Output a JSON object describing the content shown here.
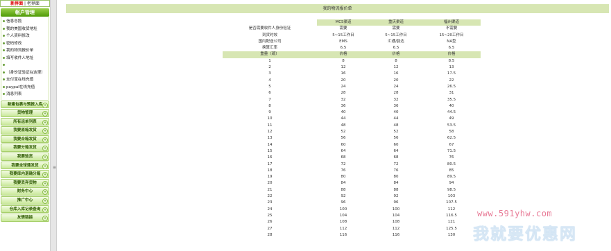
{
  "sidebar": {
    "topnav": {
      "active": "新界面",
      "separator": " | ",
      "other": "老界面"
    },
    "account_header": "帐户管理",
    "account_items": [
      "信息总揽",
      "我的美国收货地址",
      "个人资料修改",
      "密码修改",
      "我的物流报价单",
      "填写收件人地址",
      "",
      "（身份证验证在这里）",
      "支付宝在线充值",
      "paypal在线充值",
      "消息列表"
    ],
    "menus": [
      "新建包裹与预报入库",
      "货物管理",
      "所有运单列表",
      "我要原箱发货",
      "我要合箱发货",
      "我要分箱发货",
      "我要验货",
      "我要全球通发货",
      "我要库内退确分箱",
      "我要丢弃货物",
      "财务中心",
      "推广中心",
      "仓库入库记录查询",
      "友情链接"
    ]
  },
  "main": {
    "title": "我的物流报价单",
    "channels": [
      "MCS渠道",
      "重庆渠道",
      "福州渠道"
    ],
    "info_rows": [
      {
        "label": "是否需要收件人身份验证",
        "values": [
          "需要",
          "需要",
          "不需要"
        ]
      },
      {
        "label": "到货时效",
        "values": [
          "5~15工作日",
          "5~15工作日",
          "15~20工作日"
        ]
      },
      {
        "label": "国内配送公司",
        "values": [
          "EMS",
          "汇通/韵达",
          "NA型"
        ]
      },
      {
        "label": "换算汇率",
        "values": [
          "6.5",
          "6.5",
          "6.5"
        ]
      }
    ],
    "weight_header": {
      "label": "重量（磅）",
      "price": "价格"
    },
    "price_rows": [
      [
        "1",
        "8",
        "8",
        "8.5"
      ],
      [
        "2",
        "12",
        "12",
        "13"
      ],
      [
        "3",
        "16",
        "16",
        "17.5"
      ],
      [
        "4",
        "20",
        "20",
        "22"
      ],
      [
        "5",
        "24",
        "24",
        "26.5"
      ],
      [
        "6",
        "28",
        "28",
        "31"
      ],
      [
        "7",
        "32",
        "32",
        "35.5"
      ],
      [
        "8",
        "36",
        "36",
        "40"
      ],
      [
        "9",
        "40",
        "40",
        "44.5"
      ],
      [
        "10",
        "44",
        "44",
        "49"
      ],
      [
        "11",
        "48",
        "48",
        "53.5"
      ],
      [
        "12",
        "52",
        "52",
        "58"
      ],
      [
        "13",
        "56",
        "56",
        "62.5"
      ],
      [
        "14",
        "60",
        "60",
        "67"
      ],
      [
        "15",
        "64",
        "64",
        "71.5"
      ],
      [
        "16",
        "68",
        "68",
        "76"
      ],
      [
        "17",
        "72",
        "72",
        "80.5"
      ],
      [
        "18",
        "76",
        "76",
        "85"
      ],
      [
        "19",
        "80",
        "80",
        "89.5"
      ],
      [
        "20",
        "84",
        "84",
        "94"
      ],
      [
        "21",
        "88",
        "88",
        "98.5"
      ],
      [
        "22",
        "92",
        "92",
        "103"
      ],
      [
        "23",
        "96",
        "96",
        "107.5"
      ],
      [
        "24",
        "100",
        "100",
        "112"
      ],
      [
        "25",
        "104",
        "104",
        "116.5"
      ],
      [
        "26",
        "108",
        "108",
        "121"
      ],
      [
        "27",
        "112",
        "112",
        "125.5"
      ],
      [
        "28",
        "116",
        "116",
        "130"
      ]
    ]
  },
  "watermark": {
    "url": "www.591yhw.com",
    "text": "我就要优惠网"
  },
  "colors": {
    "menu_green": "#4e9a06",
    "header_bg": "#d7e6b3",
    "active_red": "#dd0000"
  }
}
